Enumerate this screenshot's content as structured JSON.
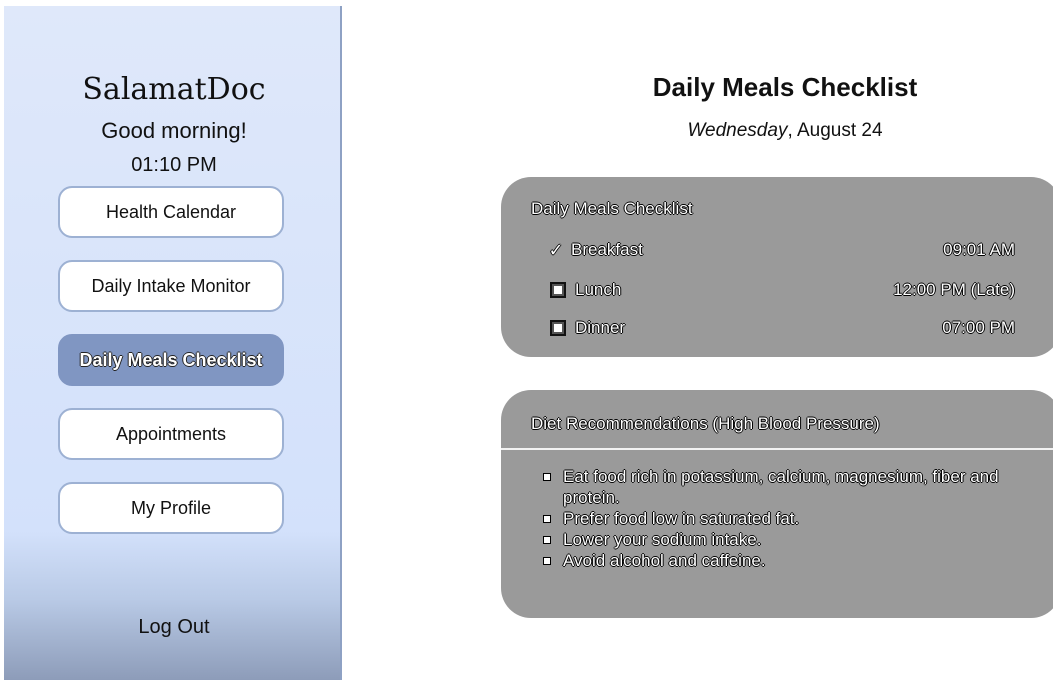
{
  "sidebar": {
    "brand": "SalamatDoc",
    "greeting": "Good morning!",
    "time": "01:10 PM",
    "nav": [
      {
        "label": "Health Calendar",
        "active": false
      },
      {
        "label": "Daily Intake Monitor",
        "active": false
      },
      {
        "label": "Daily Meals Checklist",
        "active": true
      },
      {
        "label": "Appointments",
        "active": false
      },
      {
        "label": "My Profile",
        "active": false
      }
    ],
    "logout": "Log Out"
  },
  "main": {
    "title": "Daily Meals Checklist",
    "day": "Wednesday",
    "date": ", August 24",
    "checklist": {
      "title": "Daily Meals Checklist",
      "meals": [
        {
          "name": "Breakfast",
          "time": "09:01 AM",
          "checked": true,
          "icon": "check-icon"
        },
        {
          "name": "Lunch",
          "time": "12:00 PM (Late)",
          "checked": false,
          "icon": "checkbox-icon"
        },
        {
          "name": "Dinner",
          "time": "07:00 PM",
          "checked": false,
          "icon": "checkbox-icon"
        }
      ]
    },
    "diet": {
      "title": "Diet Recommendations (High Blood Pressure)",
      "items": [
        "Eat food rich in potassium, calcium, magnesium, fiber and protein.",
        "Prefer food low in saturated fat.",
        "Lower your sodium intake.",
        "Avoid alcohol and caffeine."
      ]
    }
  },
  "colors": {
    "sidebar_bg": "#d3e1fb",
    "active_nav": "#8096c2",
    "card_bg": "#9a9a9a"
  }
}
